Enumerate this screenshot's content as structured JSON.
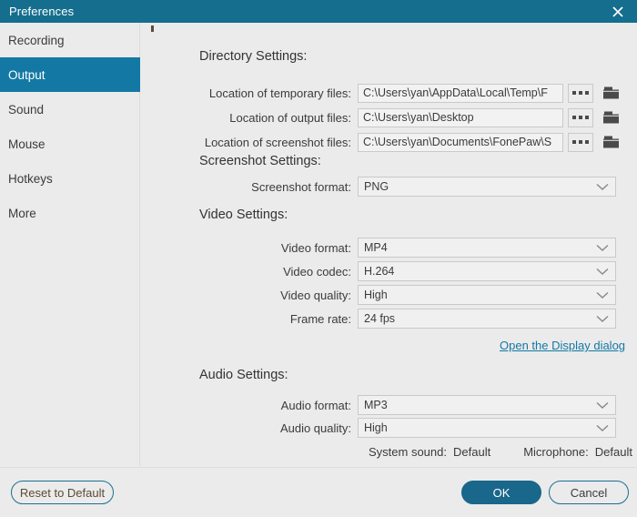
{
  "window": {
    "title": "Preferences",
    "close_icon": "close-icon",
    "accent_color": "#156e8e",
    "active_item_color": "#1379a4",
    "background_color": "#ebebeb"
  },
  "sidebar": {
    "items": [
      {
        "label": "Recording",
        "active": false
      },
      {
        "label": "Output",
        "active": true
      },
      {
        "label": "Sound",
        "active": false
      },
      {
        "label": "Mouse",
        "active": false
      },
      {
        "label": "Hotkeys",
        "active": false
      },
      {
        "label": "More",
        "active": false
      }
    ]
  },
  "main": {
    "directory": {
      "heading": "Directory Settings:",
      "rows": [
        {
          "label": "Location of temporary files:",
          "value": "C:\\Users\\yan\\AppData\\Local\\Temp\\F",
          "browse_label": "...",
          "browse_icon": "ellipsis-icon",
          "folder_icon": "folder-icon"
        },
        {
          "label": "Location of output files:",
          "value": "C:\\Users\\yan\\Desktop",
          "browse_label": "...",
          "browse_icon": "ellipsis-icon",
          "folder_icon": "folder-icon"
        },
        {
          "label": "Location of screenshot files:",
          "value": "C:\\Users\\yan\\Documents\\FonePaw\\S",
          "browse_label": "...",
          "browse_icon": "ellipsis-icon",
          "folder_icon": "folder-icon"
        }
      ]
    },
    "screenshot": {
      "heading": "Screenshot Settings:",
      "rows": [
        {
          "label": "Screenshot format:",
          "value": "PNG",
          "icon": "chevron-down-icon"
        }
      ]
    },
    "video": {
      "heading": "Video Settings:",
      "rows": [
        {
          "label": "Video format:",
          "value": "MP4",
          "icon": "chevron-down-icon"
        },
        {
          "label": "Video codec:",
          "value": "H.264",
          "icon": "chevron-down-icon"
        },
        {
          "label": "Video quality:",
          "value": "High",
          "icon": "chevron-down-icon"
        },
        {
          "label": "Frame rate:",
          "value": "24 fps",
          "icon": "chevron-down-icon"
        }
      ],
      "display_link": "Open the Display dialog"
    },
    "audio": {
      "heading": "Audio Settings:",
      "rows": [
        {
          "label": "Audio format:",
          "value": "MP3",
          "icon": "chevron-down-icon"
        },
        {
          "label": "Audio quality:",
          "value": "High",
          "icon": "chevron-down-icon"
        }
      ],
      "system_sound_label": "System sound:",
      "system_sound_value": "Default",
      "microphone_label": "Microphone:",
      "microphone_value": "Default"
    }
  },
  "footer": {
    "reset_label": "Reset to Default",
    "ok_label": "OK",
    "cancel_label": "Cancel"
  }
}
